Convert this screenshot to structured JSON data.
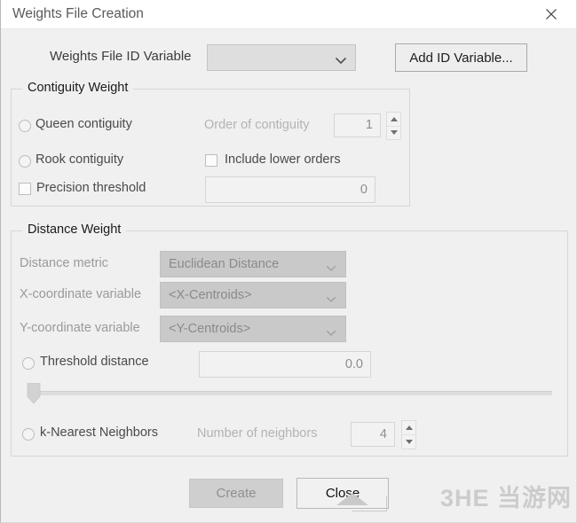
{
  "window": {
    "title": "Weights File Creation",
    "close_icon": "close-x-icon"
  },
  "id_variable_row": {
    "label": "Weights File ID Variable",
    "combo_value": "",
    "combo_placeholder": "",
    "add_button_label": "Add ID Variable..."
  },
  "contiguity": {
    "group_title": "Contiguity Weight",
    "queen_label": "Queen contiguity",
    "rook_label": "Rook contiguity",
    "precision_label": "Precision threshold",
    "order_label": "Order of contiguity",
    "order_value": "1",
    "include_lower_label": "Include lower orders",
    "precision_value": "0"
  },
  "distance": {
    "group_title": "Distance Weight",
    "metric_label": "Distance metric",
    "metric_value": "Euclidean Distance",
    "x_label": "X-coordinate variable",
    "x_value": "<X-Centroids>",
    "y_label": "Y-coordinate variable",
    "y_value": "<Y-Centroids>",
    "threshold_label": "Threshold distance",
    "threshold_value": "0.0",
    "knn_label": "k-Nearest Neighbors",
    "neighbors_label": "Number of neighbors",
    "neighbors_value": "4"
  },
  "footer": {
    "create_label": "Create",
    "close_label": "Close",
    "watermark": "3HE 当游网"
  },
  "colors": {
    "window_bg": "#f0f0f0",
    "titlebar_bg": "#ffffff",
    "disabled_combo": "#c9c9c9",
    "accent_text": "#1a1a1a"
  }
}
